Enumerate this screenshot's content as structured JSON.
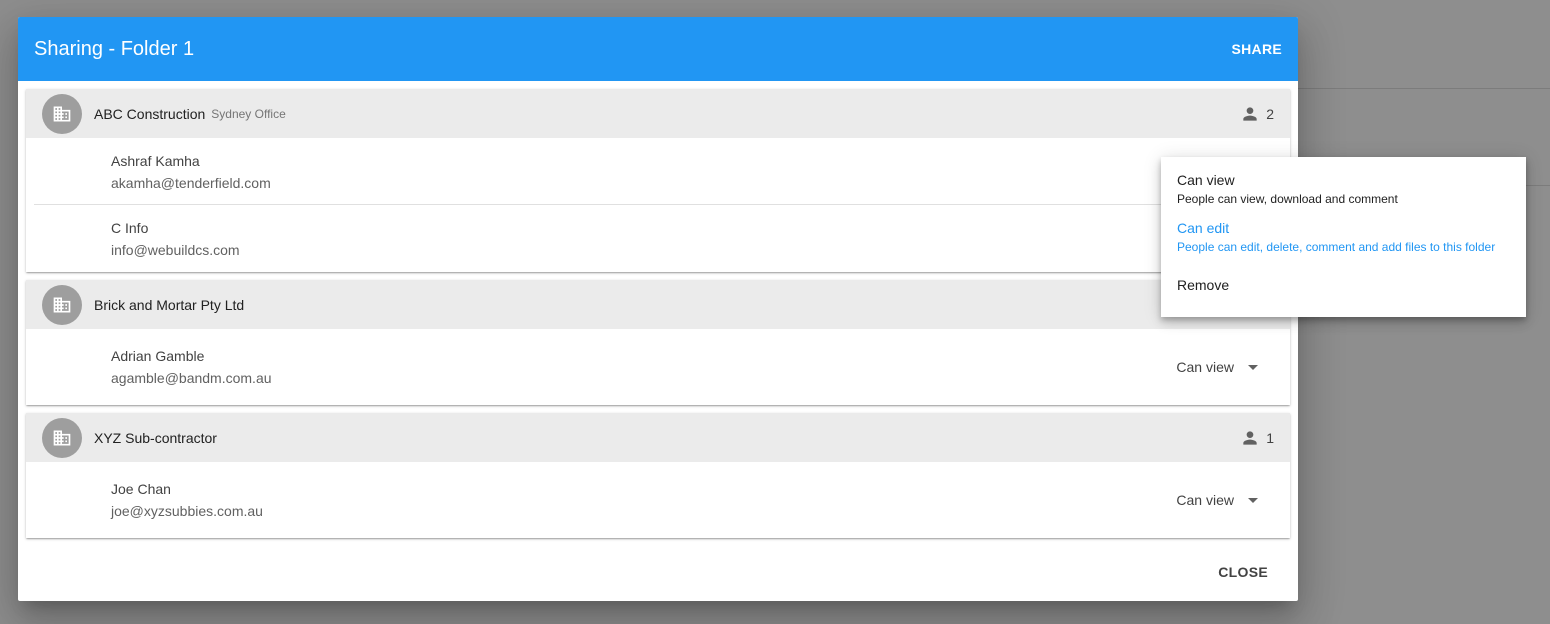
{
  "dialog": {
    "title": "Sharing - Folder 1",
    "share_label": "SHARE",
    "close_label": "CLOSE"
  },
  "groups": [
    {
      "name": "ABC Construction",
      "subtitle": "Sydney Office",
      "member_count": "2",
      "members": [
        {
          "name": "Ashraf Kamha",
          "email": "akamha@tenderfield.com"
        },
        {
          "name": "C Info",
          "email": "info@webuildcs.com"
        }
      ]
    },
    {
      "name": "Brick and Mortar Pty Ltd",
      "members": [
        {
          "name": "Adrian Gamble",
          "email": "agamble@bandm.com.au",
          "permission": "Can view"
        }
      ]
    },
    {
      "name": "XYZ Sub-contractor",
      "member_count": "1",
      "members": [
        {
          "name": "Joe Chan",
          "email": "joe@xyzsubbies.com.au",
          "permission": "Can view"
        }
      ]
    }
  ],
  "permission_menu": {
    "items": [
      {
        "label": "Can view",
        "description": "People can view, download and comment"
      },
      {
        "label": "Can edit",
        "description": "People can edit, delete, comment and add files to this folder",
        "selected": true
      },
      {
        "label": "Remove"
      }
    ]
  },
  "colors": {
    "header": "#2196f3",
    "accent": "#2196f3",
    "group_header": "#ebebeb",
    "avatar": "#9e9e9e",
    "backdrop": "#8e8e8e"
  },
  "icons": {
    "org": "business-icon",
    "members": "person-icon",
    "dropdown": "arrow-drop-down-icon"
  }
}
